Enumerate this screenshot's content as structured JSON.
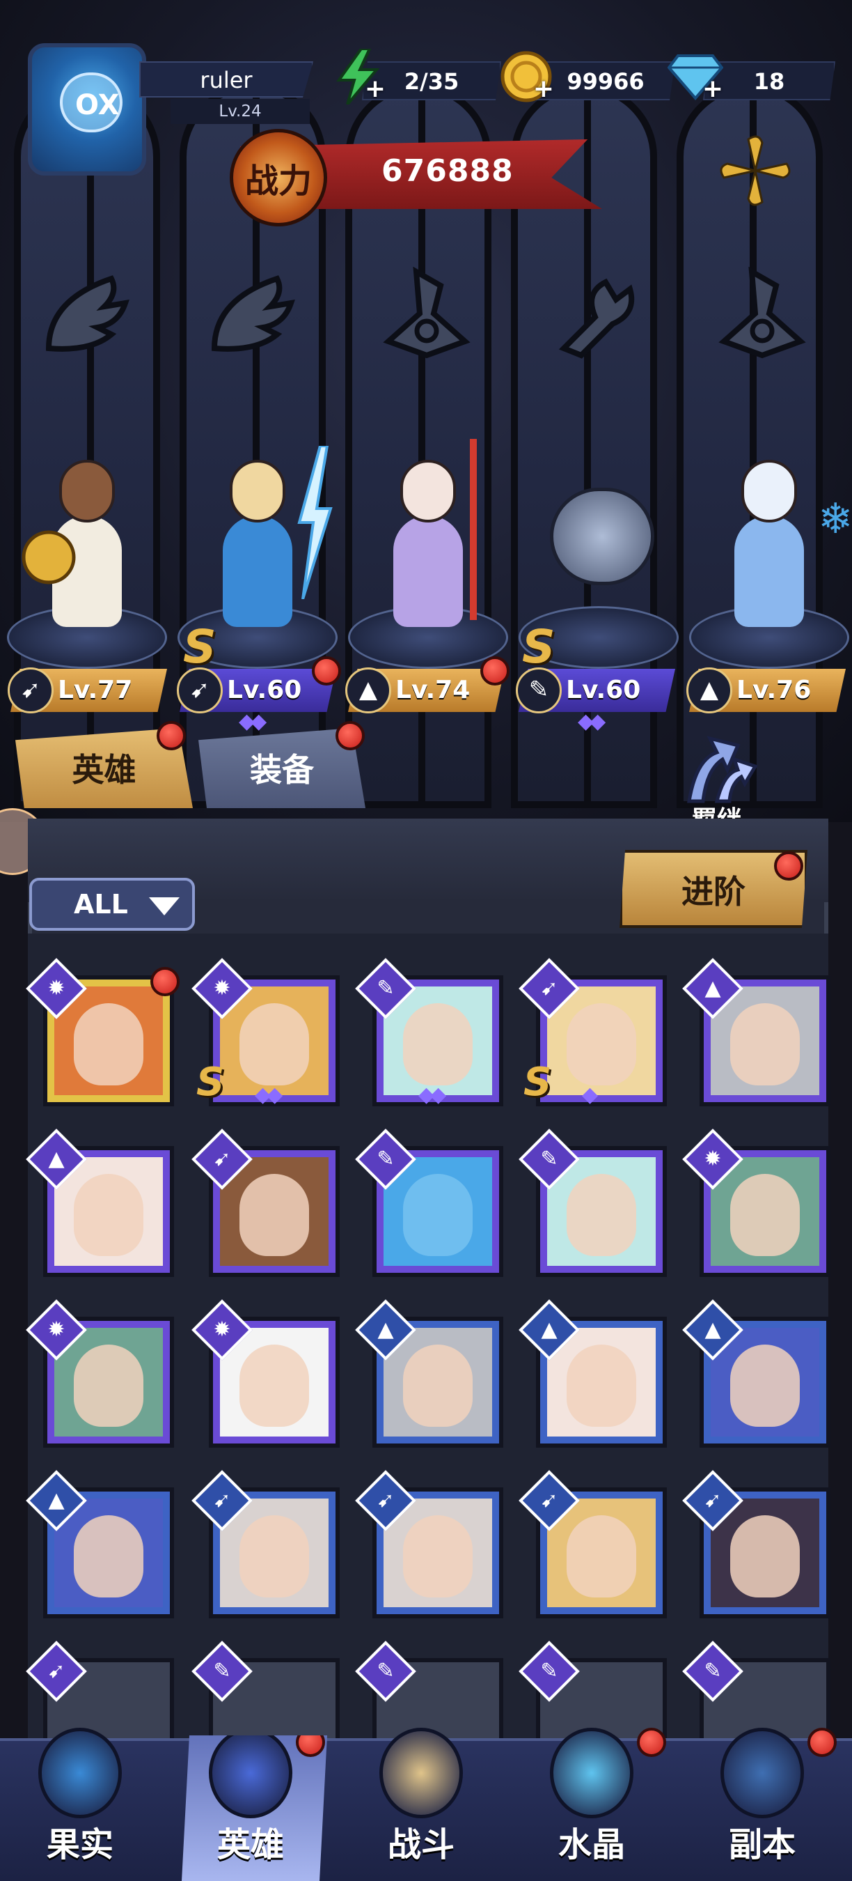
{
  "player": {
    "name": "ruler",
    "level": "Lv.24",
    "avatar_text": "OX"
  },
  "resources": {
    "energy": "2/35",
    "gold": "99966",
    "diamonds": "18"
  },
  "power": {
    "label": "战力",
    "value": "676888"
  },
  "class_slots": [
    "wing-class-icon",
    "wing-class-icon",
    "mage-hat-class-icon",
    "wrench-class-icon",
    "mage-hat-class-icon"
  ],
  "lineup": [
    {
      "level": "Lv.77",
      "tag_color": "gold",
      "class": "wing",
      "s_rank": false,
      "red_dot": false,
      "stars": ""
    },
    {
      "level": "Lv.60",
      "tag_color": "purple",
      "class": "wing",
      "s_rank": true,
      "red_dot": true,
      "stars": "◆◆"
    },
    {
      "level": "Lv.74",
      "tag_color": "gold",
      "class": "mage",
      "s_rank": false,
      "red_dot": true,
      "stars": ""
    },
    {
      "level": "Lv.60",
      "tag_color": "purple",
      "class": "wrench",
      "s_rank": true,
      "red_dot": false,
      "stars": "◆◆"
    },
    {
      "level": "Lv.76",
      "tag_color": "gold",
      "class": "mage",
      "s_rank": false,
      "red_dot": false,
      "stars": ""
    }
  ],
  "tabs": {
    "heroes": "英雄",
    "equipment": "装备",
    "bond": "羁绊"
  },
  "filter": {
    "label": "ALL"
  },
  "advance_button": "进阶",
  "roster": [
    {
      "rarity": "gold",
      "class": "beast",
      "color": "#e07a3a",
      "s": false,
      "stars": "",
      "dot": true
    },
    {
      "rarity": "purple",
      "class": "beast",
      "color": "#e6b25a",
      "s": true,
      "stars": "◆◆",
      "dot": false
    },
    {
      "rarity": "purple",
      "class": "wrench",
      "color": "#bfe8e6",
      "s": false,
      "stars": "◆◆",
      "dot": false
    },
    {
      "rarity": "purple",
      "class": "wing",
      "color": "#f0d7a0",
      "s": true,
      "stars": "◆",
      "dot": false
    },
    {
      "rarity": "purple",
      "class": "mage",
      "color": "#b9bcc4",
      "s": false,
      "stars": "",
      "dot": false
    },
    {
      "rarity": "purple",
      "class": "mage",
      "color": "#f3e4de",
      "s": false,
      "stars": "",
      "dot": false
    },
    {
      "rarity": "purple",
      "class": "wing",
      "color": "#8a5a3c",
      "s": false,
      "stars": "",
      "dot": false
    },
    {
      "rarity": "purple",
      "class": "wrench",
      "color": "#4aa8e8",
      "s": false,
      "stars": "",
      "dot": false
    },
    {
      "rarity": "purple",
      "class": "wrench",
      "color": "#bfe8e6",
      "s": false,
      "stars": "",
      "dot": false
    },
    {
      "rarity": "purple",
      "class": "beast",
      "color": "#6fa493",
      "s": false,
      "stars": "",
      "dot": false
    },
    {
      "rarity": "purple",
      "class": "beast",
      "color": "#6fa493",
      "s": false,
      "stars": "",
      "dot": false
    },
    {
      "rarity": "purple",
      "class": "beast",
      "color": "#f4f4f4",
      "s": false,
      "stars": "",
      "dot": false
    },
    {
      "rarity": "blue",
      "class": "mage",
      "color": "#b9bcc4",
      "s": false,
      "stars": "",
      "dot": false
    },
    {
      "rarity": "blue",
      "class": "mage",
      "color": "#f3e4de",
      "s": false,
      "stars": "",
      "dot": false
    },
    {
      "rarity": "blue",
      "class": "mage",
      "color": "#4b5dc4",
      "s": false,
      "stars": "",
      "dot": false
    },
    {
      "rarity": "blue",
      "class": "mage",
      "color": "#4b5dc4",
      "s": false,
      "stars": "",
      "dot": false
    },
    {
      "rarity": "blue",
      "class": "wing",
      "color": "#d9d2d0",
      "s": false,
      "stars": "",
      "dot": false
    },
    {
      "rarity": "blue",
      "class": "wing",
      "color": "#d9d2d0",
      "s": false,
      "stars": "",
      "dot": false
    },
    {
      "rarity": "blue",
      "class": "wing",
      "color": "#e7c27a",
      "s": false,
      "stars": "",
      "dot": false
    },
    {
      "rarity": "blue",
      "class": "wing",
      "color": "#3d3349",
      "s": false,
      "stars": "",
      "dot": false
    },
    {
      "rarity": "gray",
      "class": "wing",
      "color": "#3b4154",
      "s": false,
      "stars": "",
      "dot": false
    },
    {
      "rarity": "gray",
      "class": "wrench",
      "color": "#3b4154",
      "s": false,
      "stars": "",
      "dot": false
    },
    {
      "rarity": "gray",
      "class": "wrench",
      "color": "#3b4154",
      "s": false,
      "stars": "",
      "dot": false
    },
    {
      "rarity": "gray",
      "class": "wrench",
      "color": "#3b4154",
      "s": false,
      "stars": "",
      "dot": false
    },
    {
      "rarity": "gray",
      "class": "wrench",
      "color": "#3b4154",
      "s": false,
      "stars": "",
      "dot": false
    }
  ],
  "bottom_nav": [
    {
      "label": "果实",
      "active": false,
      "dot": false
    },
    {
      "label": "英雄",
      "active": true,
      "dot": true
    },
    {
      "label": "战斗",
      "active": false,
      "dot": false
    },
    {
      "label": "水晶",
      "active": false,
      "dot": true
    },
    {
      "label": "副本",
      "active": false,
      "dot": true
    }
  ],
  "colors": {
    "gold": "#e3c347",
    "purple": "#6a4bd6",
    "blue": "#3e63c4",
    "accent_red": "#c81f1a"
  }
}
